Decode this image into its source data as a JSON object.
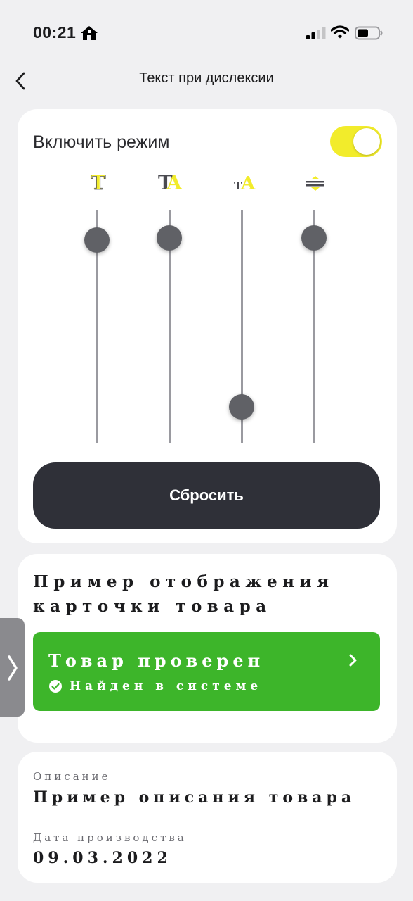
{
  "status_bar": {
    "time": "00:21",
    "icons": [
      "home-icon",
      "signal-icon",
      "wifi-icon",
      "battery-icon"
    ]
  },
  "nav": {
    "title": "Текст при дислексии",
    "back_icon": "chevron-left-icon"
  },
  "settings": {
    "toggle_label": "Включить режим",
    "toggle_on": true,
    "sliders": [
      {
        "name": "font-weight",
        "icon": "T",
        "icon_name": "font-weight-icon",
        "level": 0.9
      },
      {
        "name": "letter-spacing",
        "icon": "TA",
        "icon_name": "letter-spacing-icon",
        "level": 0.91
      },
      {
        "name": "font-size",
        "icon": "TA",
        "icon_name": "font-size-icon",
        "level": 0.13
      },
      {
        "name": "line-height",
        "icon": "≑",
        "icon_name": "line-height-icon",
        "level": 0.91
      }
    ],
    "reset_label": "Сбросить"
  },
  "preview": {
    "title": "Пример отображения карточки товара",
    "status_title": "Товар проверен",
    "status_sub": "Найден в системе"
  },
  "info": {
    "desc_label": "Описание",
    "desc_value": "Пример описания товара",
    "date_label": "Дата производства",
    "date_value": "09.03.2022"
  },
  "colors": {
    "accent_yellow": "#f2ec2b",
    "success_green": "#3db52a",
    "button_dark": "#2f3038",
    "thumb_gray": "#606166"
  }
}
